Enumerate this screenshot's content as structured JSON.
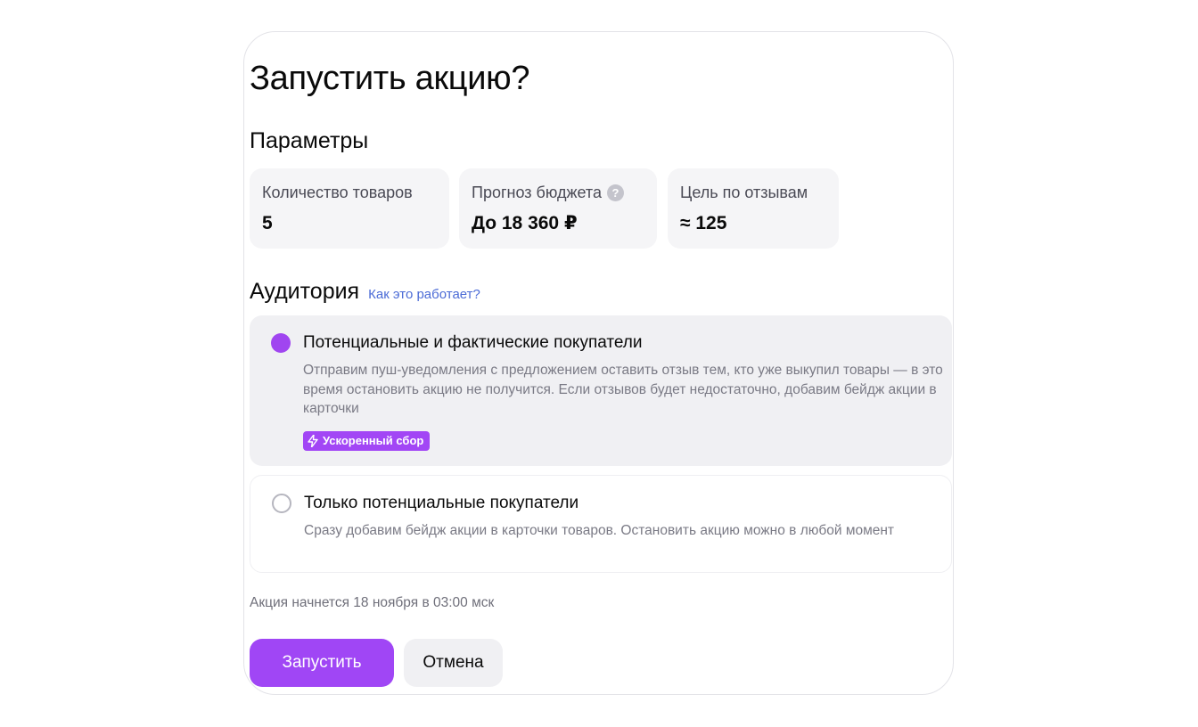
{
  "dialog": {
    "title": "Запустить акцию?",
    "params": {
      "title": "Параметры",
      "cards": [
        {
          "label": "Количество товаров",
          "value": "5"
        },
        {
          "label": "Прогноз бюджета",
          "value": "До 18 360 ₽",
          "icon": "help-icon"
        },
        {
          "label": "Цель по отзывам",
          "value": "≈ 125"
        }
      ]
    },
    "audience": {
      "title": "Аудитория",
      "help_link": "Как это работает?",
      "options": [
        {
          "title": "Потенциальные и фактические покупатели",
          "description": "Отправим пуш-уведомления с предложением оставить отзыв тем, кто уже выкупил товары — в это время остановить акцию не получится. Если отзывов будет недостаточно, добавим бейдж акции в карточки",
          "badge": "Ускоренный сбор",
          "badge_icon": "bolt-icon",
          "selected": true
        },
        {
          "title": "Только потенциальные покупатели",
          "description": "Сразу добавим бейдж акции в карточки товаров. Остановить акцию можно в любой момент",
          "selected": false
        }
      ]
    },
    "start_note": "Акция начнется 18 ноября в 03:00 мск",
    "buttons": {
      "primary": "Запустить",
      "secondary": "Отмена"
    },
    "colors": {
      "accent": "#a046f5",
      "link": "#4b6bd6",
      "card_bg": "#f5f5f7"
    }
  }
}
